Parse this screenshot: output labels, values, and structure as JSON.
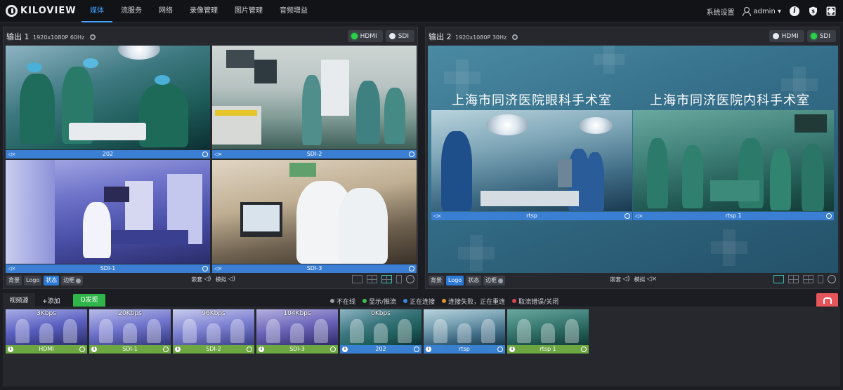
{
  "app": {
    "logo_text": "KILOVIEW"
  },
  "nav": {
    "items": [
      "媒体",
      "流服务",
      "网络",
      "录像管理",
      "图片管理",
      "音频增益"
    ],
    "active": "媒体"
  },
  "header": {
    "settings": "系统设置",
    "user": "admin ▾"
  },
  "output1": {
    "title": "输出 1",
    "format": "1920x1080P 60Hz",
    "buttons": [
      "HDMI",
      "SDI"
    ],
    "active_button": "HDMI",
    "cells": [
      "202",
      "SDI-2",
      "SDI-1",
      "SDI-3"
    ],
    "tags": [
      "背景",
      "Logo",
      "状态",
      "边框"
    ],
    "audio": [
      "嵌套",
      "模拟"
    ]
  },
  "output2": {
    "title": "输出 2",
    "format": "1920x1080P 30Hz",
    "buttons": [
      "HDMI",
      "SDI"
    ],
    "active_button": "SDI",
    "titles": [
      "上海市同济医院眼科手术室",
      "上海市同济医院内科手术室"
    ],
    "cells": [
      "rtsp",
      "rtsp 1"
    ],
    "tags": [
      "背景",
      "Logo",
      "状态",
      "边框"
    ],
    "audio": [
      "嵌套",
      "模拟"
    ]
  },
  "sources": {
    "tab": "视频源",
    "add": "+添加",
    "discover": "Q发现",
    "legend": [
      {
        "label": "不在线",
        "color": "#9a9ea6"
      },
      {
        "label": "显示/推流",
        "color": "#3dbf4c"
      },
      {
        "label": "正在连接",
        "color": "#3a86e0"
      },
      {
        "label": "连接失败，正在重连",
        "color": "#d9962b"
      },
      {
        "label": "取流错误/关闭",
        "color": "#d9454b"
      }
    ],
    "items": [
      {
        "name": "HDMI",
        "rate": "3Kbps",
        "status_color": "#6da742"
      },
      {
        "name": "SDI-1",
        "rate": "20Kbps",
        "status_color": "#6da742"
      },
      {
        "name": "SDI-2",
        "rate": "96Kbps",
        "status_color": "#6da742"
      },
      {
        "name": "SDI-3",
        "rate": "104Kbps",
        "status_color": "#6da742"
      },
      {
        "name": "202",
        "rate": "0Kbps",
        "status_color": "#3a80d0"
      },
      {
        "name": "rtsp",
        "rate": "",
        "status_color": "#3a80d0"
      },
      {
        "name": "rtsp 1",
        "rate": "",
        "status_color": "#6da742"
      }
    ]
  }
}
